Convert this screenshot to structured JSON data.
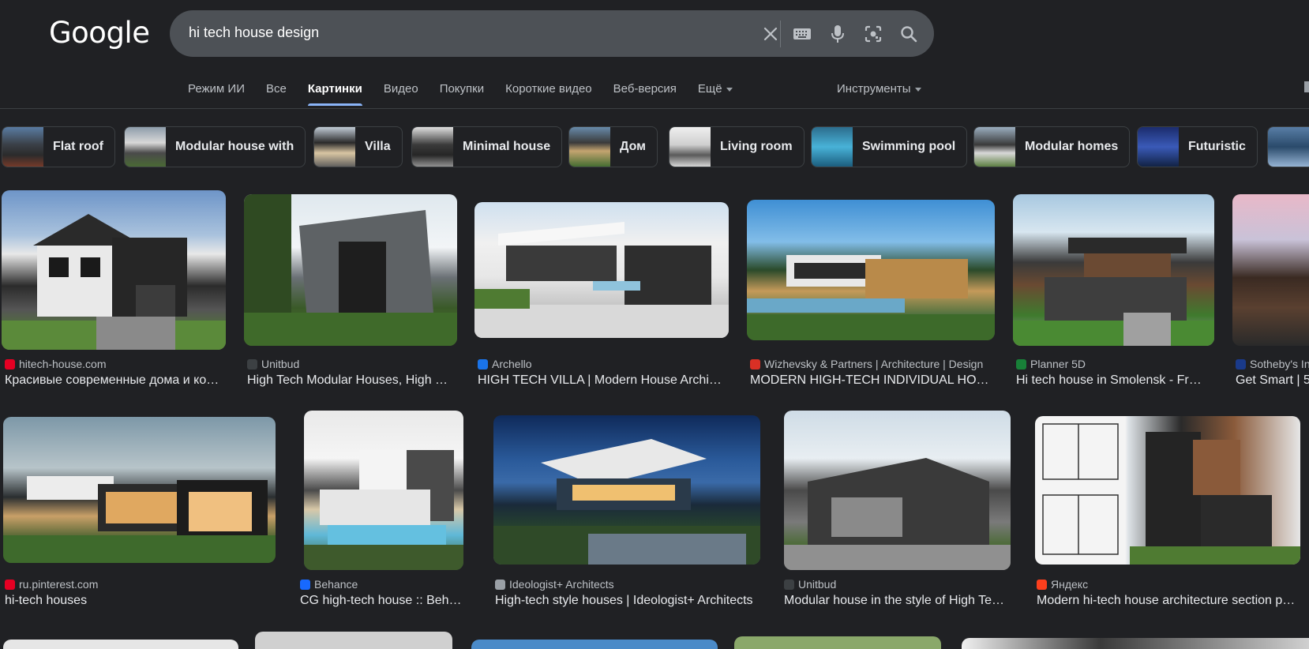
{
  "header": {
    "logo": "Google",
    "query": "hi tech house design"
  },
  "tabs": [
    {
      "label": "Режим ИИ"
    },
    {
      "label": "Все"
    },
    {
      "label": "Картинки",
      "active": true
    },
    {
      "label": "Видео"
    },
    {
      "label": "Покупки"
    },
    {
      "label": "Короткие видео"
    },
    {
      "label": "Веб-версия"
    },
    {
      "label": "Ещё"
    }
  ],
  "tools_label": "Инструменты",
  "chips": [
    {
      "label": "Flat roof"
    },
    {
      "label": "Modular house with"
    },
    {
      "label": "Villa"
    },
    {
      "label": "Minimal house"
    },
    {
      "label": "Дом"
    },
    {
      "label": "Living room"
    },
    {
      "label": "Swimming pool"
    },
    {
      "label": "Modular homes"
    },
    {
      "label": "Futuristic"
    }
  ],
  "row1": [
    {
      "source": "hitech-house.com",
      "title": "Красивые современные дома и ко…",
      "favicon_color": "#e60023"
    },
    {
      "source": "Unitbud",
      "title": "High Tech Modular Houses, High …",
      "favicon_color": "#3c4043"
    },
    {
      "source": "Archello",
      "title": "HIGH TECH VILLA | Modern House Archi…",
      "favicon_color": "#1a73e8"
    },
    {
      "source": "Wizhevsky & Partners | Architecture | Design",
      "title": "MODERN HIGH-TECH INDIVIDUAL HO…",
      "favicon_color": "#d93025"
    },
    {
      "source": "Planner 5D",
      "title": "Hi tech house in Smolensk - Fr…",
      "favicon_color": "#188038"
    },
    {
      "source": "Sotheby's In",
      "title": "Get Smart | 5",
      "favicon_color": "#1a3a8a"
    }
  ],
  "row2": [
    {
      "source": "ru.pinterest.com",
      "title": "hi-tech houses",
      "favicon_color": "#e60023"
    },
    {
      "source": "Behance",
      "title": "CG high-tech house :: Beh…",
      "favicon_color": "#1769ff"
    },
    {
      "source": "Ideologist+ Architects",
      "title": "High-tech style houses | Ideologist+ Architects",
      "favicon_color": "#9aa0a6"
    },
    {
      "source": "Unitbud",
      "title": "Modular house in the style of High Te…",
      "favicon_color": "#3c4043"
    },
    {
      "source": "Яндекс",
      "title": "Modern hi-tech house architecture section p…",
      "favicon_color": "#fc3f1d"
    }
  ],
  "colors": {
    "background": "#202124",
    "searchbox": "#4d5156",
    "accent": "#8ab4f8"
  }
}
